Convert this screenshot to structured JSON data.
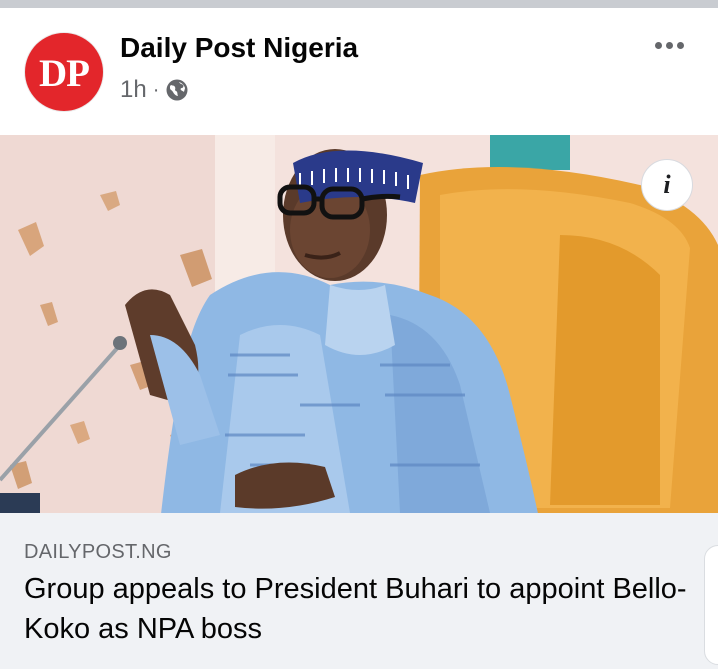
{
  "post": {
    "avatar_text": "DP",
    "page_name": "Daily Post Nigeria",
    "time": "1h",
    "separator": "·",
    "audience_icon": "globe-icon",
    "more_icon": "more-horizontal-icon"
  },
  "image": {
    "info_label": "i"
  },
  "link": {
    "domain": "DAILYPOST.NG",
    "headline": "Group appeals to President Buhari to appoint Bello-Koko as NPA boss"
  },
  "colors": {
    "brand_red": "#e3262b",
    "card_bg": "#f0f2f5",
    "secondary_text": "#65676b"
  }
}
